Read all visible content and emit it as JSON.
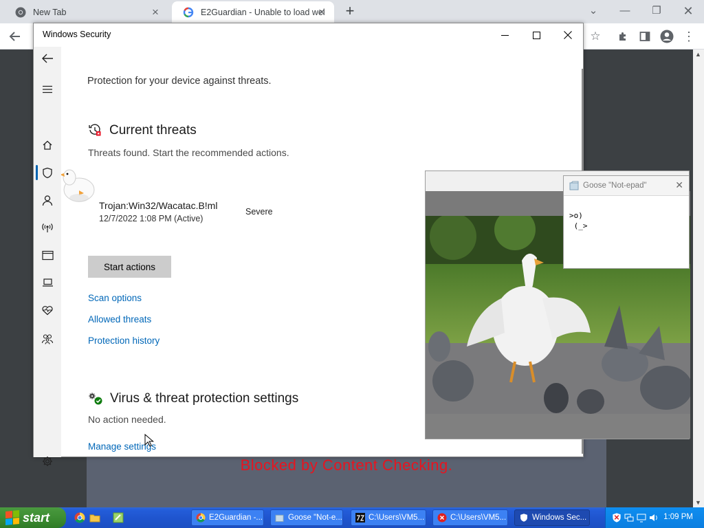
{
  "browser": {
    "tabs": [
      {
        "label": "New Tab",
        "active": false
      },
      {
        "label": "E2Guardian - Unable to load wel",
        "active": true
      }
    ]
  },
  "page": {
    "blocked_message": "Blocked by Content Checking."
  },
  "windows_security": {
    "title": "Windows Security",
    "intro": "Protection for your device against threats.",
    "current_threats": {
      "heading": "Current threats",
      "subtitle": "Threats found. Start the recommended actions.",
      "threat_name": "Trojan:Win32/Wacatac.B!ml",
      "threat_date": "12/7/2022 1:08 PM (Active)",
      "severity": "Severe",
      "start_button": "Start actions",
      "links": [
        "Scan options",
        "Allowed threats",
        "Protection history"
      ]
    },
    "settings": {
      "heading": "Virus & threat protection settings",
      "status": "No action needed.",
      "link": "Manage settings"
    }
  },
  "goose_notepad": {
    "title": "Goose \"Not-epad\"",
    "line1": ">o)",
    "line2": " (_>"
  },
  "taskbar": {
    "start_label": "start",
    "buttons": [
      {
        "label": "E2Guardian -..."
      },
      {
        "label": "Goose \"Not-e..."
      },
      {
        "label": "C:\\Users\\VM5..."
      },
      {
        "label": "C:\\Users\\VM5..."
      },
      {
        "label": "Windows Sec..."
      }
    ],
    "clock": "1:09 PM"
  },
  "colors": {
    "link": "#0067b8",
    "blocked_text": "#e8141f",
    "nav_selected": "#0063b1",
    "taskbar": "#245edb",
    "start_button": "#3a8a30"
  }
}
